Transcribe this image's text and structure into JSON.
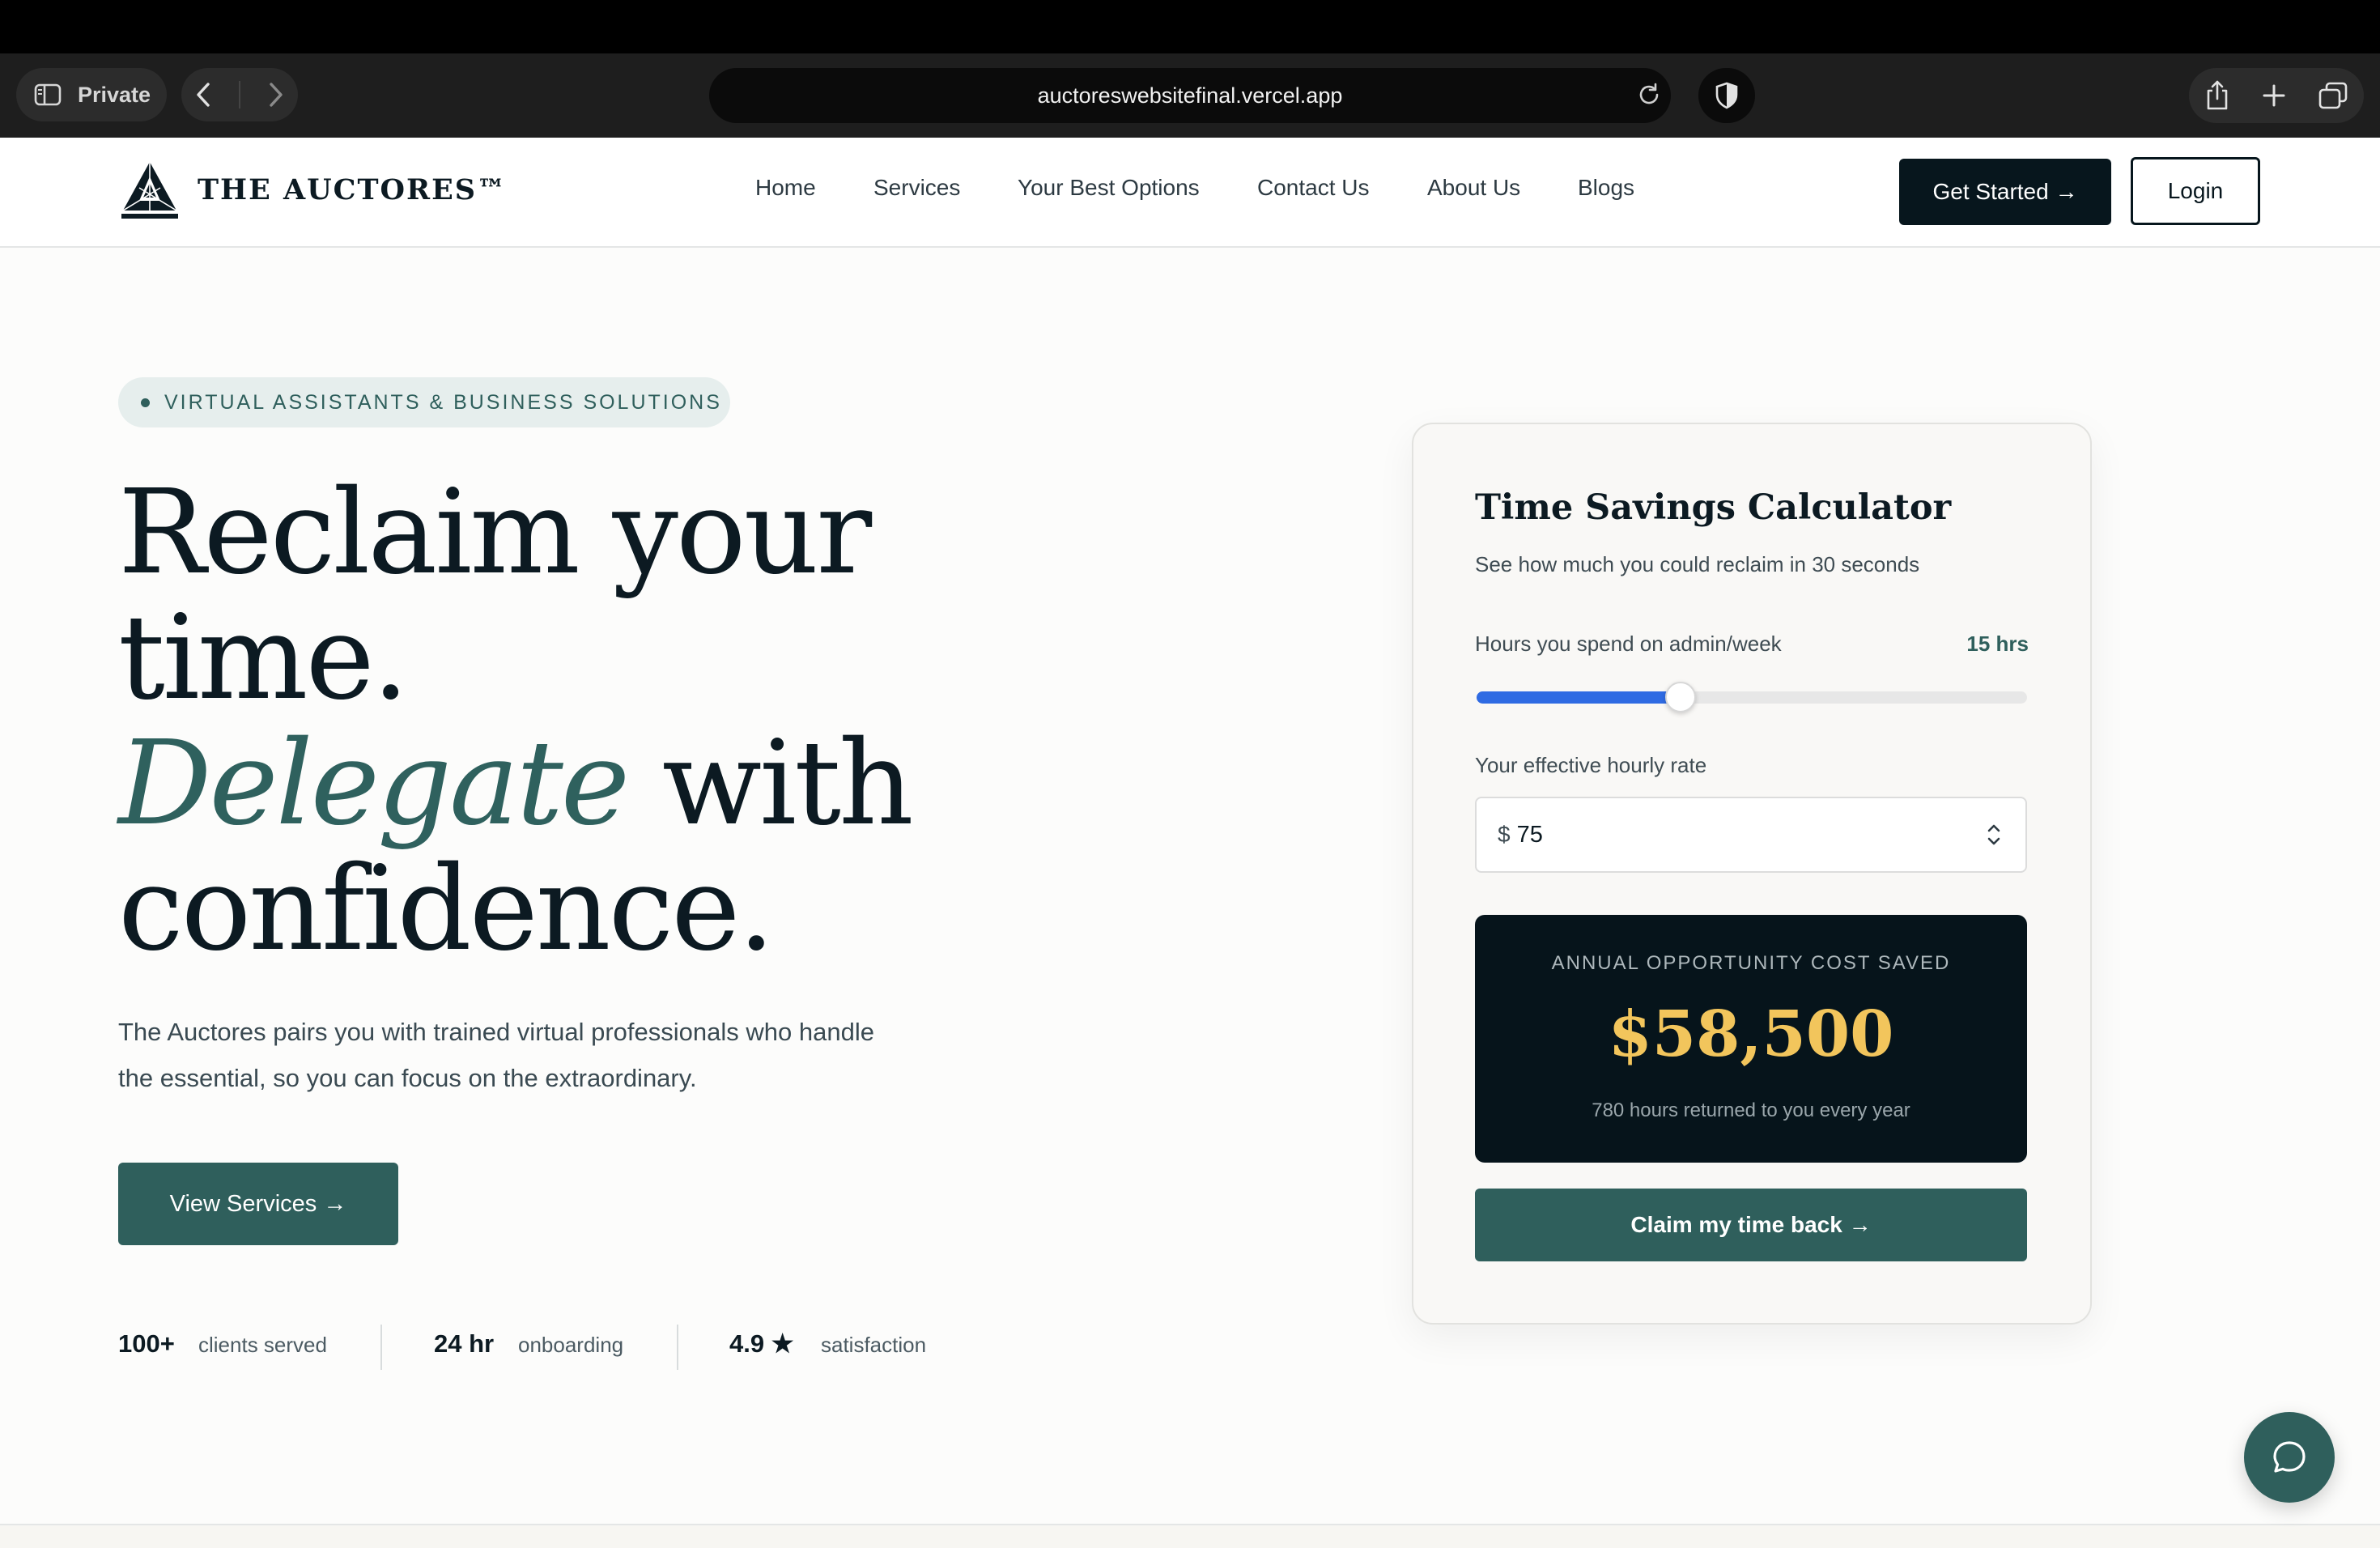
{
  "browser": {
    "private_label": "Private",
    "url": "auctoreswebsitefinal.vercel.app"
  },
  "header": {
    "brand": "THE AUCTORES™",
    "nav": [
      "Home",
      "Services",
      "Your Best Options",
      "Contact Us",
      "About Us",
      "Blogs"
    ],
    "get_started": "Get Started →",
    "login": "Login"
  },
  "hero": {
    "badge": "VIRTUAL ASSISTANTS & BUSINESS SOLUTIONS",
    "line1": "Reclaim your",
    "line2": "time.",
    "line3_accent": "Delegate",
    "line3_rest": " with",
    "line4": "confidence.",
    "subcopy": "The Auctores pairs you with trained virtual professionals who handle the essential, so you can focus on the extraordinary.",
    "cta": "View Services →",
    "stats": [
      {
        "value": "100+",
        "label": "clients served"
      },
      {
        "value": "24 hr",
        "label": "onboarding"
      },
      {
        "value": "4.9 ★",
        "label": "satisfaction"
      }
    ]
  },
  "calculator": {
    "title": "Time Savings Calculator",
    "subtitle": "See how much you could reclaim in 30 seconds",
    "hours_label": "Hours you spend on admin/week",
    "hours_value": "15 hrs",
    "slider_fraction": 0.37,
    "rate_label": "Your effective hourly rate",
    "currency": "$",
    "rate_value": "75",
    "result_label": "ANNUAL OPPORTUNITY COST SAVED",
    "result_value": "$58,500",
    "result_note": "780 hours returned to you every year",
    "cta": "Claim my time back →"
  },
  "colors": {
    "accent_teal": "#2f5f5c",
    "dark": "#07161d",
    "gold": "#f2c55c",
    "slider_blue": "#2f6be3"
  },
  "icons": {
    "sidebar": "sidebar-icon",
    "back": "chevron-left-icon",
    "forward": "chevron-right-icon",
    "reload": "reload-icon",
    "shield": "shield-icon",
    "share": "share-icon",
    "new_tab": "plus-icon",
    "tabs": "tabs-overview-icon",
    "chat": "chat-bubble-icon"
  }
}
